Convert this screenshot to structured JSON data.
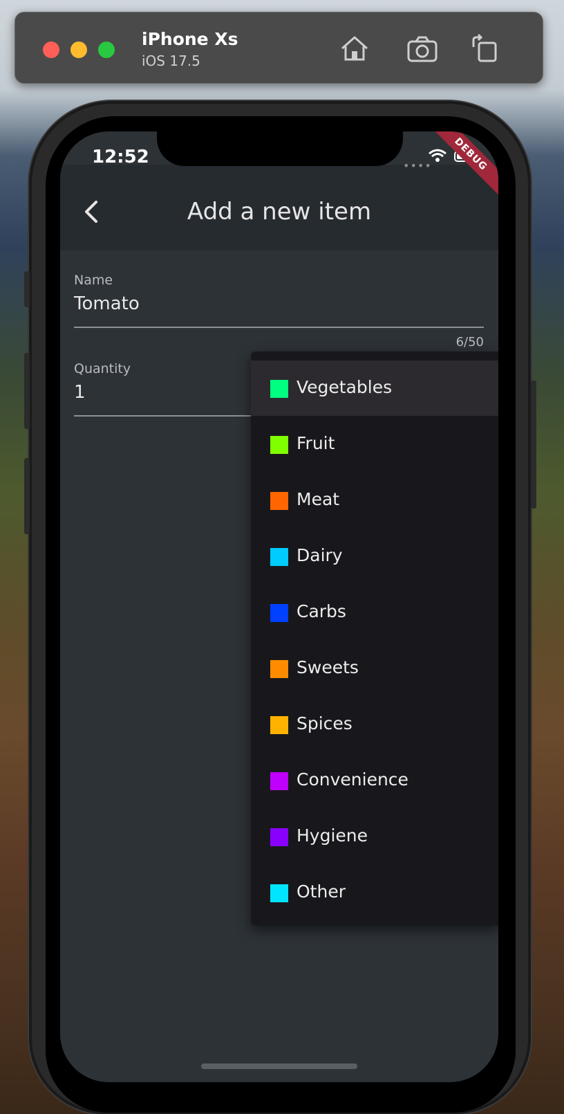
{
  "simulator": {
    "device_name": "iPhone Xs",
    "os_version": "iOS 17.5",
    "home_icon": "home-icon",
    "screenshot_icon": "camera-icon",
    "rotate_icon": "rotate-icon"
  },
  "status_bar": {
    "time": "12:52",
    "signal": "••••",
    "debug_banner": "DEBUG"
  },
  "app_bar": {
    "title": "Add a new item",
    "back_icon": "chevron-left-icon"
  },
  "form": {
    "name": {
      "label": "Name",
      "value": "Tomato",
      "counter": "6/50"
    },
    "quantity": {
      "label": "Quantity",
      "value": "1"
    }
  },
  "category_menu": {
    "selected": "Vegetables",
    "items": [
      {
        "label": "Vegetables",
        "color": "#00ff80"
      },
      {
        "label": "Fruit",
        "color": "#80ff00"
      },
      {
        "label": "Meat",
        "color": "#ff6600"
      },
      {
        "label": "Dairy",
        "color": "#00ccff"
      },
      {
        "label": "Carbs",
        "color": "#0040ff"
      },
      {
        "label": "Sweets",
        "color": "#ff8c00"
      },
      {
        "label": "Spices",
        "color": "#ffb300"
      },
      {
        "label": "Convenience",
        "color": "#bf00ff"
      },
      {
        "label": "Hygiene",
        "color": "#8a00ff"
      },
      {
        "label": "Other",
        "color": "#00e5ff"
      }
    ]
  }
}
